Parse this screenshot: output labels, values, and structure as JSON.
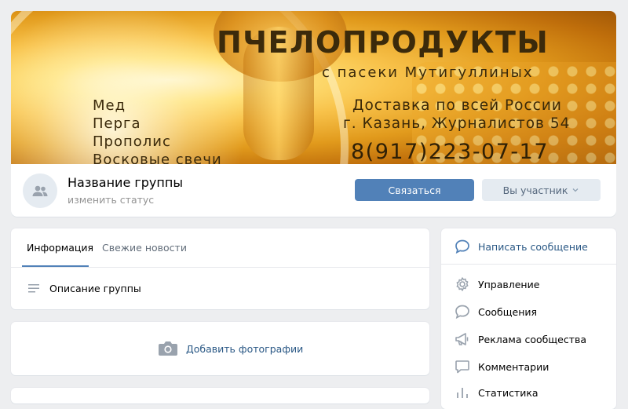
{
  "cover": {
    "title": "ПЧЕЛОПРОДУКТЫ",
    "subtitle": "с пасеки Мутигуллиных",
    "products": [
      "Мед",
      "Перга",
      "Прополис",
      "Восковые свечи"
    ],
    "delivery": "Доставка по всей России",
    "address": "г. Казань, Журналистов 54",
    "phone": "8(917)223-07-17"
  },
  "header": {
    "group_name": "Название группы",
    "status": "изменить статус",
    "contact_button": "Связаться",
    "member_button": "Вы участник"
  },
  "tabs": [
    "Информация",
    "Свежие новости"
  ],
  "info": {
    "description": "Описание группы"
  },
  "photos": {
    "label": "Добавить фотографии"
  },
  "menu": {
    "write": "Написать сообщение",
    "items": [
      "Управление",
      "Сообщения",
      "Реклама сообщества",
      "Комментарии",
      "Статистика"
    ]
  },
  "colors": {
    "accent": "#5181b8",
    "link": "#2a5885",
    "background": "#edeef0"
  }
}
